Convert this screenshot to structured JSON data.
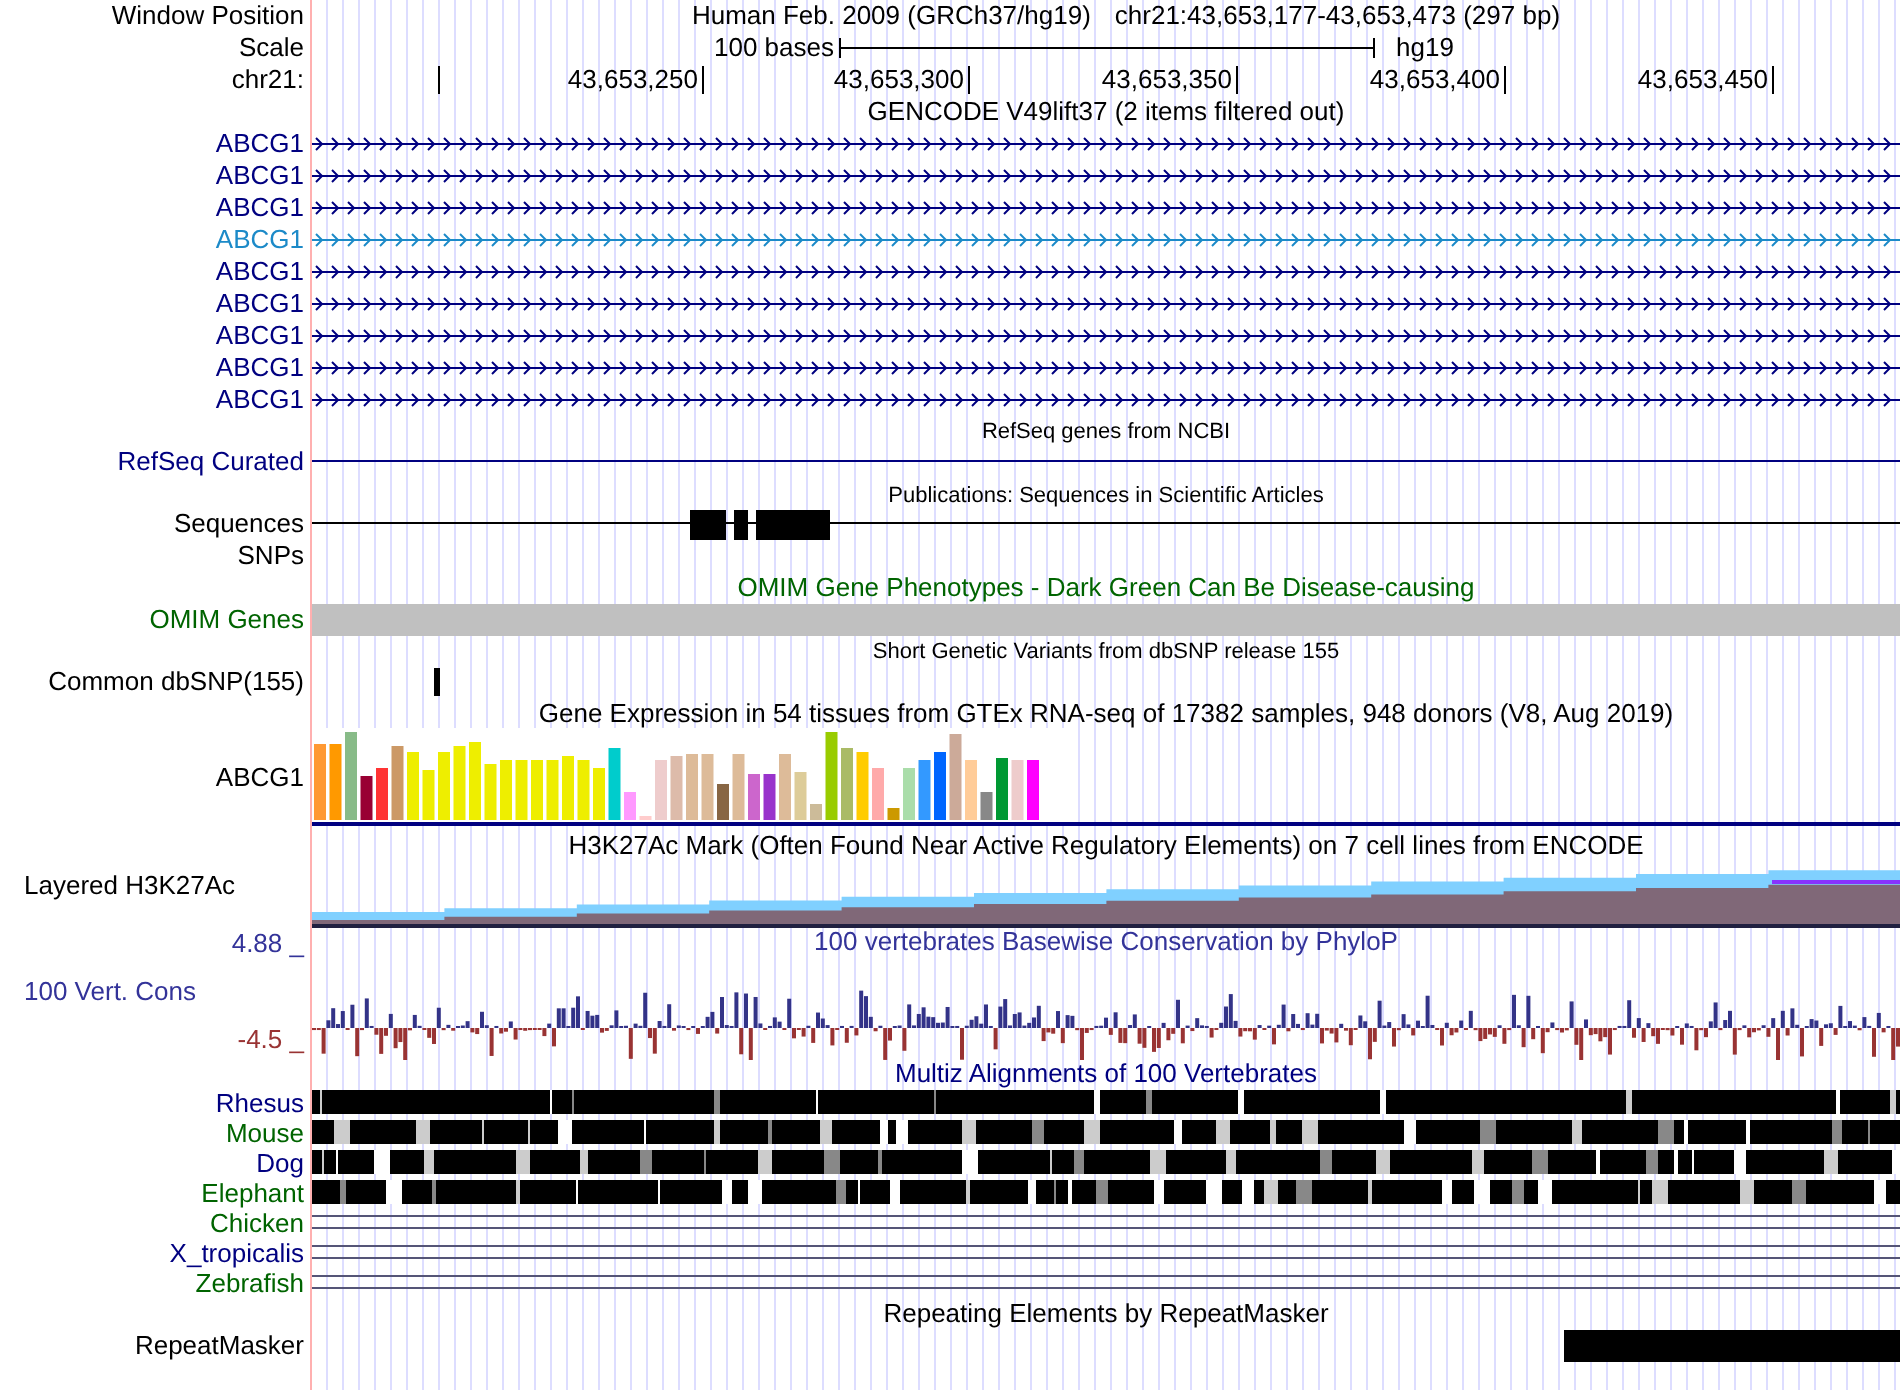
{
  "header": {
    "position_label": "Window Position",
    "assembly": "Human Feb. 2009 (GRCh37/hg19)",
    "position": "chr21:43,653,177-43,653,473 (297 bp)",
    "scale_label": "Scale",
    "scale_text": "100 bases",
    "scale_db": "hg19",
    "chrom_label": "chr21:",
    "ticks": [
      "43,653,250",
      "43,653,300",
      "43,653,350",
      "43,653,400",
      "43,653,450"
    ]
  },
  "tracks": [
    {
      "kind": "genes",
      "title": "GENCODE V49lift37 (2 items filtered out)",
      "items": [
        {
          "label": "ABCG1",
          "color": "#000080"
        },
        {
          "label": "ABCG1",
          "color": "#000080"
        },
        {
          "label": "ABCG1",
          "color": "#000080"
        },
        {
          "label": "ABCG1",
          "color": "#1c8ac8"
        },
        {
          "label": "ABCG1",
          "color": "#000080"
        },
        {
          "label": "ABCG1",
          "color": "#000080"
        },
        {
          "label": "ABCG1",
          "color": "#000080"
        },
        {
          "label": "ABCG1",
          "color": "#000080"
        },
        {
          "label": "ABCG1",
          "color": "#000080"
        }
      ]
    },
    {
      "kind": "refseq",
      "title": "RefSeq genes from NCBI",
      "label": "RefSeq Curated"
    },
    {
      "kind": "publications",
      "title": "Publications: Sequences in Scientific Articles",
      "label": "Sequences",
      "label_2": "SNPs"
    },
    {
      "kind": "omim",
      "title": "OMIM Gene Phenotypes - Dark Green Can Be Disease-causing",
      "label": "OMIM Genes"
    },
    {
      "kind": "snp",
      "title": "Short Genetic Variants from dbSNP release 155",
      "label": "Common dbSNP(155)"
    },
    {
      "kind": "gtex",
      "title": "Gene Expression in 54 tissues from GTEx RNA-seq of 17382 samples, 948 donors (V8, Aug 2019)",
      "label": "ABCG1"
    },
    {
      "kind": "h3k27ac",
      "title": "H3K27Ac Mark (Often Found Near Active Regulatory Elements) on 7 cell lines from ENCODE",
      "label": "Layered H3K27Ac"
    },
    {
      "kind": "phylop",
      "title": "100 vertebrates Basewise Conservation by PhyloP",
      "label": "100 Vert. Cons",
      "max": "4.88 _",
      "min": "-4.5 _"
    },
    {
      "kind": "multiz",
      "title": "Multiz Alignments of 100 Vertebrates",
      "species": [
        {
          "label": "Rhesus",
          "kind": "blocks",
          "color": "#000080"
        },
        {
          "label": "Mouse",
          "kind": "blocks",
          "color": "#006400"
        },
        {
          "label": "Dog",
          "kind": "blocks",
          "color": "#000080"
        },
        {
          "label": "Elephant",
          "kind": "blocks",
          "color": "#006400"
        },
        {
          "label": "Chicken",
          "kind": "lines",
          "color": "#006400"
        },
        {
          "label": "X_tropicalis",
          "kind": "lines",
          "color": "#000080"
        },
        {
          "label": "Zebrafish",
          "kind": "lines",
          "color": "#006400"
        }
      ]
    },
    {
      "kind": "repeatmasker",
      "title": "Repeating Elements by RepeatMasker",
      "label": "RepeatMasker"
    }
  ]
}
